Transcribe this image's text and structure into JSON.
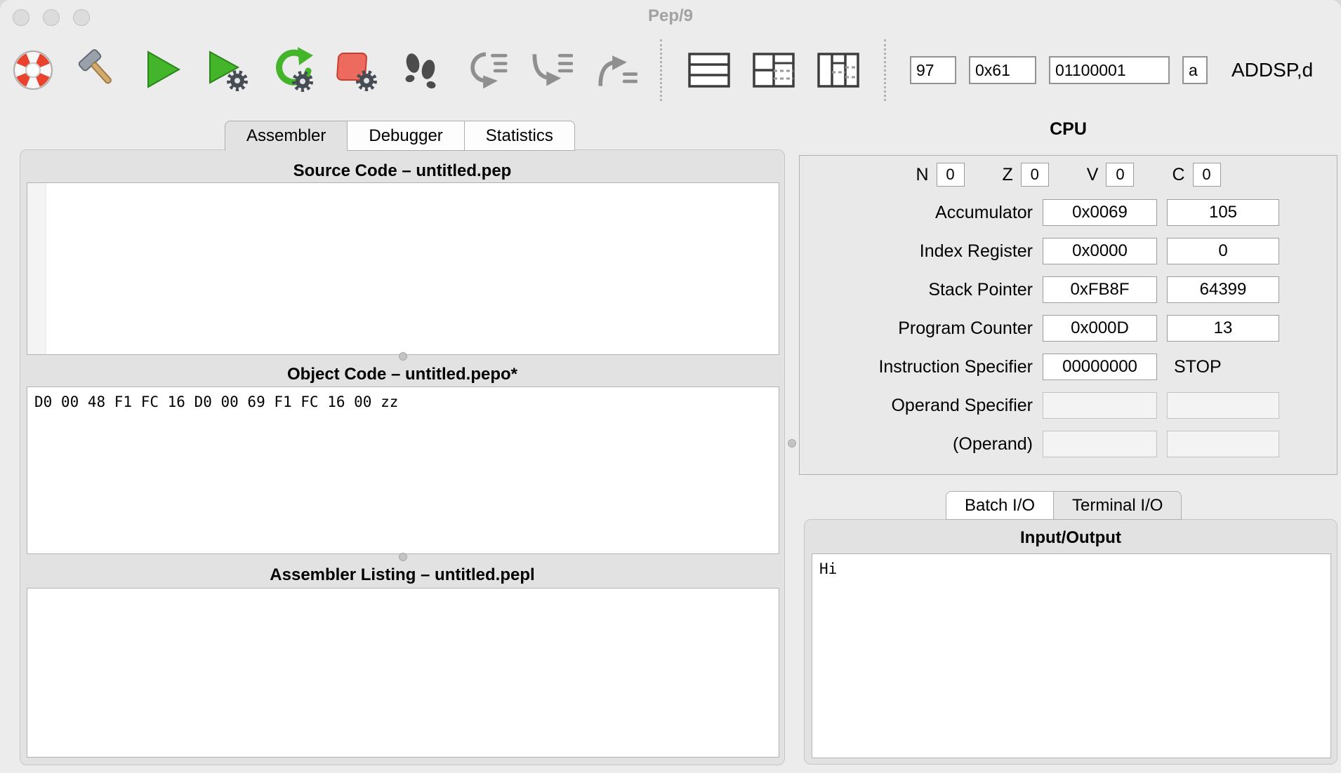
{
  "window": {
    "title": "Pep/9"
  },
  "toolbar": {
    "buttons": [
      {
        "name": "help",
        "icon": "lifebuoy-icon"
      },
      {
        "name": "build",
        "icon": "hammer-icon"
      },
      {
        "name": "run",
        "icon": "play-icon"
      },
      {
        "name": "debug",
        "icon": "play-gear-icon"
      },
      {
        "name": "restart-debug",
        "icon": "circular-arrow-gear-icon"
      },
      {
        "name": "stop-debug",
        "icon": "red-stop-gear-icon"
      },
      {
        "name": "single-step",
        "icon": "footprints-icon"
      },
      {
        "name": "step-over",
        "icon": "step-over-icon"
      },
      {
        "name": "step-into",
        "icon": "step-into-icon"
      },
      {
        "name": "step-out",
        "icon": "step-out-icon"
      },
      {
        "name": "view-code",
        "icon": "layout-code-icon"
      },
      {
        "name": "view-code-cpu",
        "icon": "layout-code-cpu-icon"
      },
      {
        "name": "view-code-cpu-memory",
        "icon": "layout-code-cpu-memory-icon"
      }
    ],
    "converter": {
      "dec": "97",
      "hex": "0x61",
      "bin": "01100001",
      "ascii": "a",
      "mnemonic": "ADDSP,d"
    }
  },
  "tabs": [
    {
      "label": "Assembler",
      "selected": true
    },
    {
      "label": "Debugger",
      "selected": false
    },
    {
      "label": "Statistics",
      "selected": false
    }
  ],
  "panels": {
    "source": {
      "title": "Source Code – untitled.pep",
      "content": ""
    },
    "object": {
      "title": "Object Code – untitled.pepo*",
      "content": "D0 00 48 F1 FC 16 D0 00 69 F1 FC 16 00 zz"
    },
    "listing": {
      "title": "Assembler Listing – untitled.pepl",
      "content": ""
    }
  },
  "cpu": {
    "title": "CPU",
    "flags": [
      {
        "label": "N",
        "value": "0"
      },
      {
        "label": "Z",
        "value": "0"
      },
      {
        "label": "V",
        "value": "0"
      },
      {
        "label": "C",
        "value": "0"
      }
    ],
    "registers": [
      {
        "label": "Accumulator",
        "hex": "0x0069",
        "dec": "105"
      },
      {
        "label": "Index Register",
        "hex": "0x0000",
        "dec": "0"
      },
      {
        "label": "Stack Pointer",
        "hex": "0xFB8F",
        "dec": "64399"
      },
      {
        "label": "Program Counter",
        "hex": "0x000D",
        "dec": "13"
      },
      {
        "label": "Instruction Specifier",
        "hex": "00000000",
        "dec": "STOP"
      },
      {
        "label": "Operand Specifier",
        "hex": "",
        "dec": ""
      },
      {
        "label": "(Operand)",
        "hex": "",
        "dec": ""
      }
    ]
  },
  "io": {
    "tabs": [
      {
        "label": "Batch I/O",
        "selected": true
      },
      {
        "label": "Terminal I/O",
        "selected": false
      }
    ],
    "title": "Input/Output",
    "content": "Hi"
  }
}
